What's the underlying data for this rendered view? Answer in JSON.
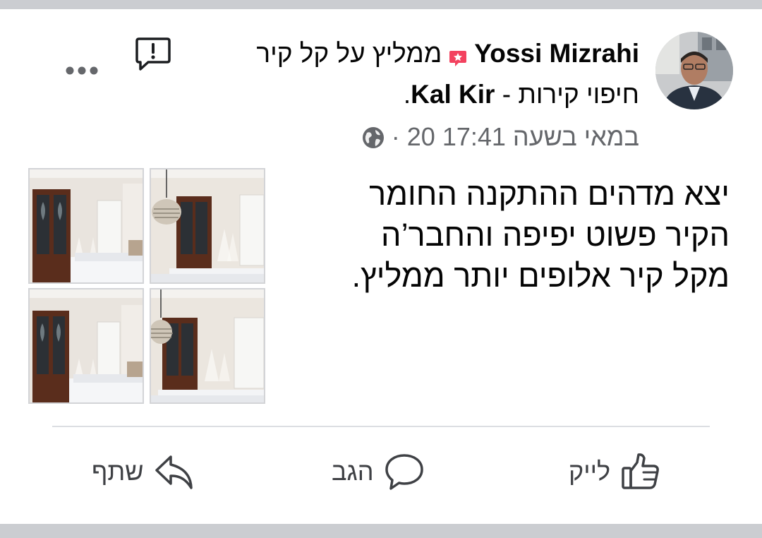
{
  "post": {
    "author": "Yossi Mizrahi",
    "recommends_text": "ממליץ על קל קיר",
    "page_name_line": {
      "prefix": "חיפוי קירות - ",
      "bold": "Kal Kir",
      "suffix": "."
    },
    "timestamp": "20 במאי בשעה 17:41",
    "separator": "·",
    "audience_icon": "globe-icon",
    "recommend_badge_icon": "recommend-star-icon",
    "recommend_badge_color": "#f3425f",
    "text_lines": [
      "יצא מדהים ההתקנה החומר",
      "הקיר פשוט יפיפה והחבר’ה",
      "מקל קיר אלופים יותר ממליץ."
    ],
    "photos_count": 4
  },
  "actions": {
    "like_label": "לייק",
    "comment_label": "הגב",
    "share_label": "שתף"
  },
  "colors": {
    "secondary_text": "#65676b",
    "band": "#cbcdd1",
    "divider": "#dcdee2"
  }
}
